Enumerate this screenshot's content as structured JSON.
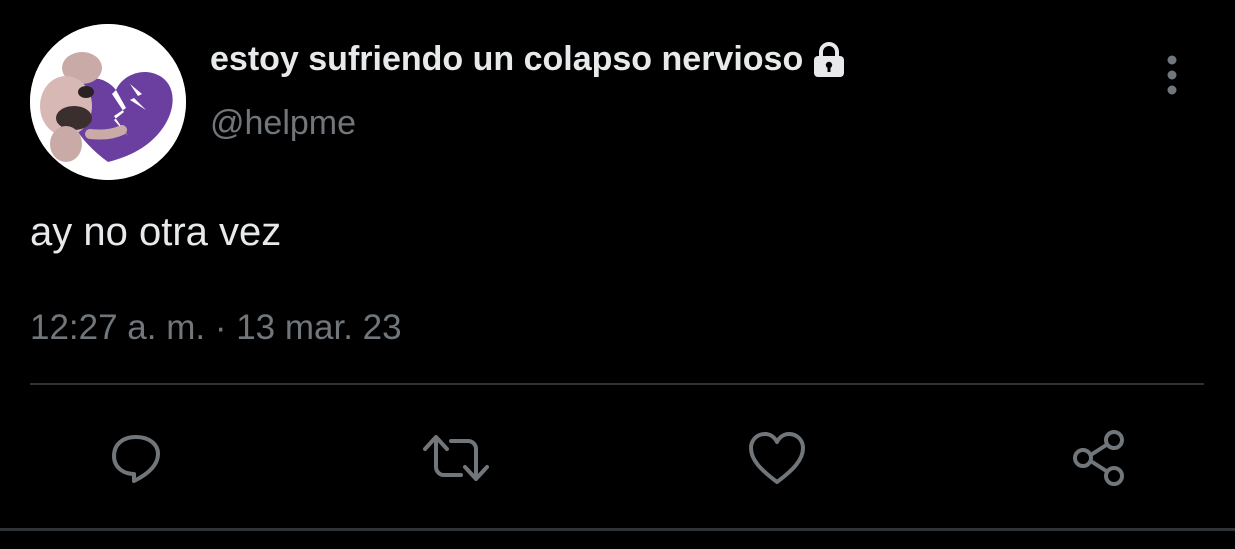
{
  "tweet": {
    "display_name": "estoy sufriendo un colapso nervioso",
    "handle": "@helpme",
    "text": "ay no otra vez",
    "timestamp": "12:27 a. m. · 13 mar. 23"
  },
  "icons": {
    "lock": "lock-icon",
    "more": "more-vertical-icon",
    "reply": "reply-icon",
    "retweet": "retweet-icon",
    "like": "heart-icon",
    "share": "share-icon"
  },
  "colors": {
    "background": "#000000",
    "primary_text": "#e7e9ea",
    "secondary_text": "#71767b",
    "divider": "#2f3336",
    "avatar_heart": "#6b3fa0"
  }
}
